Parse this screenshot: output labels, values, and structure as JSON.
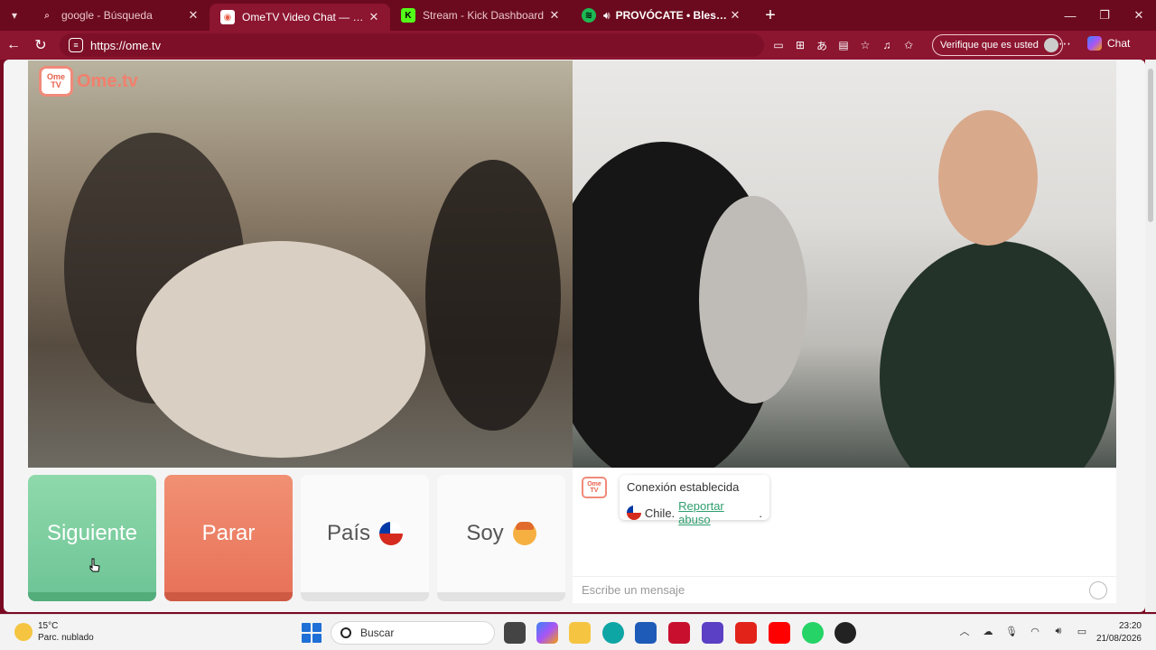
{
  "browser": {
    "tabs": [
      {
        "title": "google - Búsqueda",
        "active": false,
        "favicon": "google-icon"
      },
      {
        "title": "OmeTV Video Chat — Omegle",
        "active": true,
        "favicon": "ometv-icon"
      },
      {
        "title": "Stream - Kick Dashboard",
        "active": false,
        "favicon": "kick-icon"
      },
      {
        "title": "PROVÓCATE • Blessd, Cris MJ,",
        "active": false,
        "favicon": "spotify-icon",
        "playing": true
      }
    ],
    "url": "https://ome.tv",
    "verify_label": "Verifique que es usted",
    "copilot_label": "Chat"
  },
  "page": {
    "logo_text": "Ome.tv",
    "logo_badge": "Ome TV",
    "buttons": {
      "next": "Siguiente",
      "stop": "Parar",
      "country": "País",
      "gender": "Soy"
    },
    "chat": {
      "status": "Conexión establecida",
      "country": "Chile.",
      "report_link": "Reportar abuso",
      "report_suffix": ".",
      "input_placeholder": "Escribe un mensaje"
    }
  },
  "taskbar": {
    "weather_temp": "15°C",
    "weather_desc": "Parc. nublado",
    "search_placeholder": "Buscar",
    "time": "23:20",
    "date": "21/08/2026"
  }
}
